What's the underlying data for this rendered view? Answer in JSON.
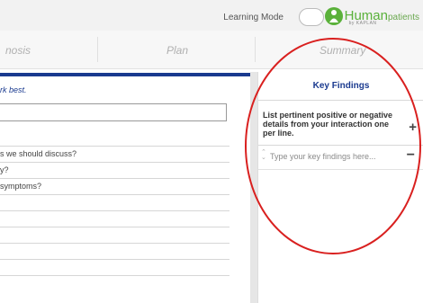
{
  "header": {
    "mode_label": "Learning Mode",
    "logo": {
      "brand": "Human",
      "suffix": "patients",
      "sub": "by KAPLAN"
    }
  },
  "tabs": [
    {
      "label": "nosis"
    },
    {
      "label": "Plan"
    },
    {
      "label": "Summary"
    }
  ],
  "left_panel": {
    "instruction": "rk best.",
    "questions": [
      "",
      "s we should discuss?",
      "y?",
      "symptoms?",
      "",
      "",
      "",
      "",
      ""
    ]
  },
  "key_findings": {
    "title": "Key Findings",
    "instruction": "List pertinent positive or negative details from your interaction one per line.",
    "input_placeholder": "Type your key findings here...",
    "add_symbol": "+",
    "remove_symbol": "−"
  },
  "colors": {
    "accent_blue": "#1a3a8f",
    "logo_green": "#5ab13a",
    "annotation_red": "#d9201f"
  }
}
